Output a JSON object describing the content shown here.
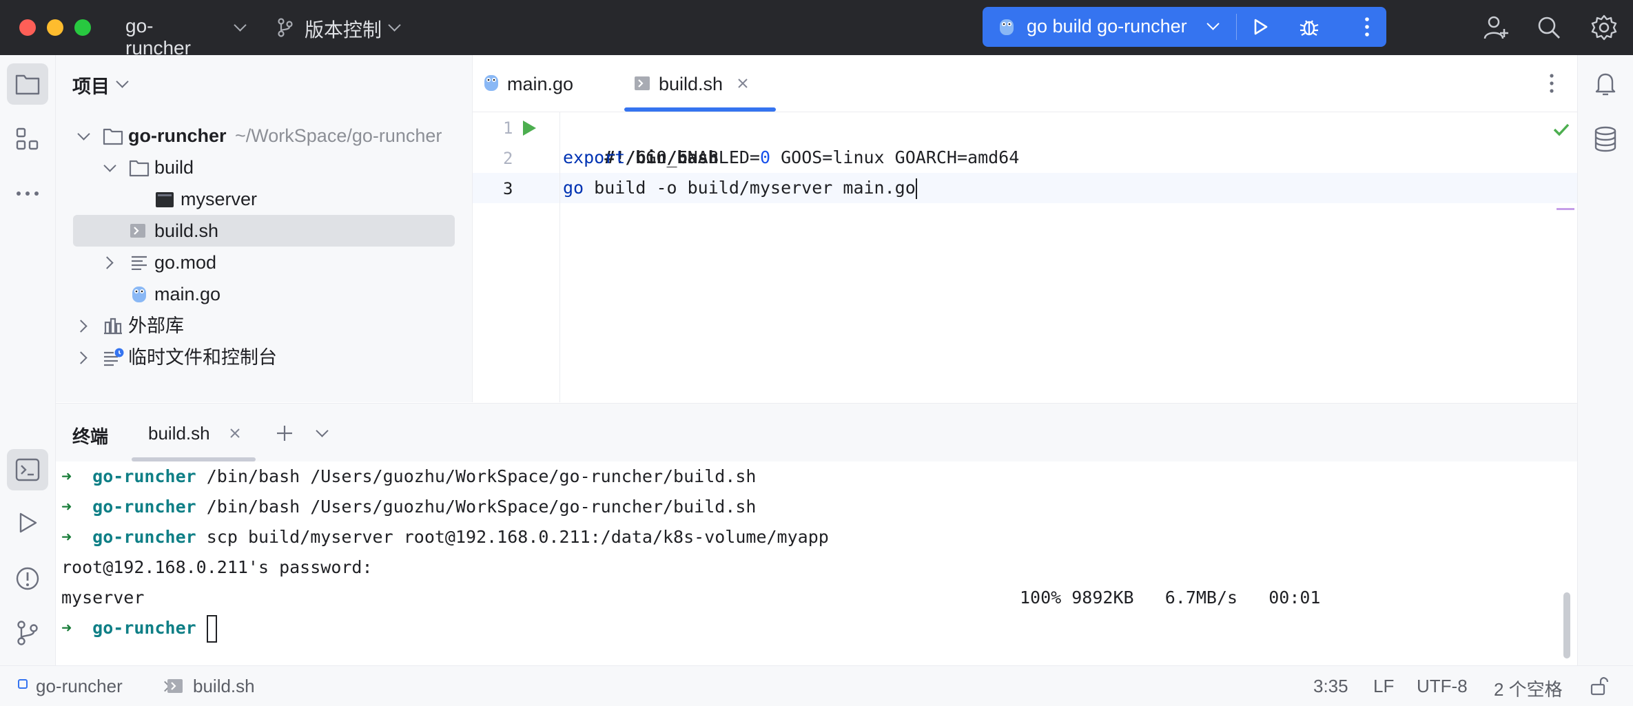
{
  "titlebar": {
    "project_name": "go-runcher",
    "vcs_label": "版本控制",
    "run_config": "go build go-runcher"
  },
  "project_panel": {
    "title": "项目",
    "tree": [
      {
        "label": "go-runcher",
        "path": "~/WorkSpace/go-runcher"
      },
      {
        "label": "build"
      },
      {
        "label": "myserver"
      },
      {
        "label": "build.sh"
      },
      {
        "label": "go.mod"
      },
      {
        "label": "main.go"
      },
      {
        "label": "外部库"
      },
      {
        "label": "临时文件和控制台"
      }
    ]
  },
  "editor": {
    "tabs": [
      {
        "label": "main.go"
      },
      {
        "label": "build.sh"
      }
    ],
    "line_numbers": [
      "1",
      "2",
      "3"
    ],
    "lines": [
      {
        "text": "#!/bin/bash"
      },
      {
        "kw": "export",
        "rest": " CGO_ENABLED=",
        "num": "0",
        "rest2": " GOOS=linux GOARCH=amd64"
      },
      {
        "kw": "go",
        "rest": " build -o build/myserver main.go"
      }
    ]
  },
  "terminal": {
    "title": "终端",
    "tab": "build.sh",
    "lines": [
      {
        "arrow": "➜",
        "dir": "go-runcher",
        "cmd": " /bin/bash /Users/guozhu/WorkSpace/go-runcher/build.sh"
      },
      {
        "arrow": "➜",
        "dir": "go-runcher",
        "cmd": " /bin/bash /Users/guozhu/WorkSpace/go-runcher/build.sh"
      },
      {
        "arrow": "➜",
        "dir": "go-runcher",
        "cmd": " scp build/myserver root@192.168.0.211:/data/k8s-volume/myapp"
      },
      {
        "text": "root@192.168.0.211's password:"
      },
      {
        "file": "myserver",
        "progress": "100% 9892KB   6.7MB/s   00:01"
      },
      {
        "arrow": "➜",
        "dir": "go-runcher"
      }
    ]
  },
  "statusbar": {
    "project": "go-runcher",
    "file": "build.sh",
    "position": "3:35",
    "line_sep": "LF",
    "encoding": "UTF-8",
    "indent": "2 个空格"
  },
  "colors": {
    "accent": "#3574f0",
    "keyword": "#0033b3",
    "number": "#1750eb",
    "run_green": "#4cae4f",
    "terminal_arrow": "#1a7d3a",
    "terminal_dir": "#0f7f86"
  }
}
